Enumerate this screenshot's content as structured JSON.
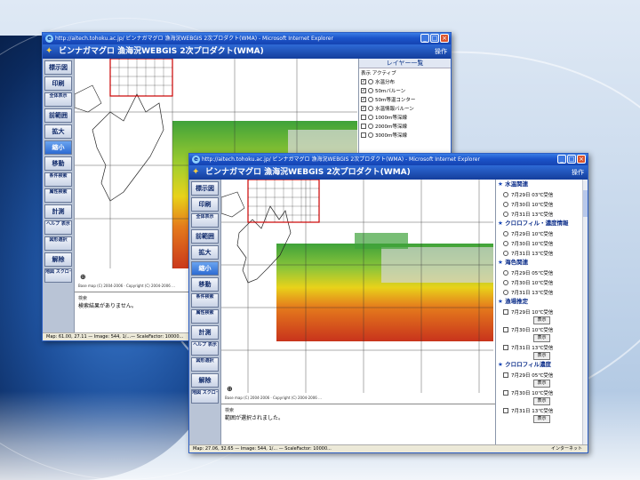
{
  "window1": {
    "title": "http://aitech.tohoku.ac.jp/ ビンナガマグロ 漁海況WEBGIS 2次プロダクト(WMA) - Microsoft Internet Explorer",
    "app_title": "ビンナガマグロ 漁海況WEBGIS 2次プロダクト(WMA)",
    "header_right": "操作",
    "tools": [
      "標示図",
      "印刷",
      "全体表示",
      "前範囲",
      "拡大",
      "縮小",
      "移動",
      "条件検索",
      "属性検索",
      "計測",
      "ヘルプ 表示",
      "図形選択",
      "解除",
      "地図 スクロール"
    ],
    "layer_panel_title": "レイヤー一覧",
    "layer_header": "表示 アクティブ",
    "layers": [
      "水温分布",
      "50mバルーン",
      "50m等温コンター",
      "水温情報バルーン",
      "1000m等深線",
      "2000m等深線",
      "3000m等深線"
    ],
    "copyright": "Base map (C) 2004-2006 · Copyright (C) 2004-2006 ...",
    "info_label": "検索",
    "info_text": "検索結果がありません。",
    "zoom_label": "縮小",
    "status": "Map: 61.00, 27.11 — Image: 544, 1/...— ScaleFactor: 10000..."
  },
  "window2": {
    "title": "http://aitech.tohoku.ac.jp/ ビンナガマグロ 漁海況WEBGIS 2次プロダクト(WMA) - Microsoft Internet Explorer",
    "app_title": "ビンナガマグロ 漁海況WEBGIS 2次プロダクト(WMA)",
    "header_right": "操作",
    "tools": [
      "標示図",
      "印刷",
      "全体表示",
      "前範囲",
      "拡大",
      "縮小",
      "移動",
      "条件検索",
      "属性検索",
      "計測",
      "ヘルプ 表示",
      "図形選択",
      "解除",
      "地図 スクロール"
    ],
    "sections": [
      {
        "title": "水温関連",
        "items": [
          "7月29日 03℃受信",
          "7月30日 10℃受信",
          "7月31日 13℃受信"
        ],
        "kind": "radio"
      },
      {
        "title": "クロロフィル・濃度情報",
        "items": [
          "7月29日 10℃受信",
          "7月30日 10℃受信",
          "7月31日 13℃受信"
        ],
        "kind": "radio"
      },
      {
        "title": "海色関連",
        "items": [
          "7月29日 05℃受信",
          "7月30日 10℃受信",
          "7月31日 13℃受信"
        ],
        "kind": "radio"
      },
      {
        "title": "漁場推定",
        "items": [
          "7月29日 10℃受信",
          "7月30日 10℃受信",
          "7月31日 13℃受信"
        ],
        "kind": "check",
        "sub": "表示"
      },
      {
        "title": "クロロフィル濃度",
        "items": [
          "7月29日 05℃受信",
          "7月30日 10℃受信",
          "7月31日 13℃受信"
        ],
        "kind": "check",
        "sub": "表示"
      }
    ],
    "copyright": "Base map (C) 2004-2006 · Copyright (C) 2004-2006 ...",
    "info_label": "検索",
    "info_text": "範囲が選択されました。",
    "status": "Map: 27.06, 32.65 — Image: 544, 1/... — ScaleFactor: 10000...",
    "status_right": "インターネット"
  },
  "colors": {
    "title_blue": "#1b53c9",
    "header_blue": "#143e9c",
    "sst_red": "#c8331c",
    "sst_yellow": "#e8d21a",
    "sst_green": "#3fa23a"
  }
}
